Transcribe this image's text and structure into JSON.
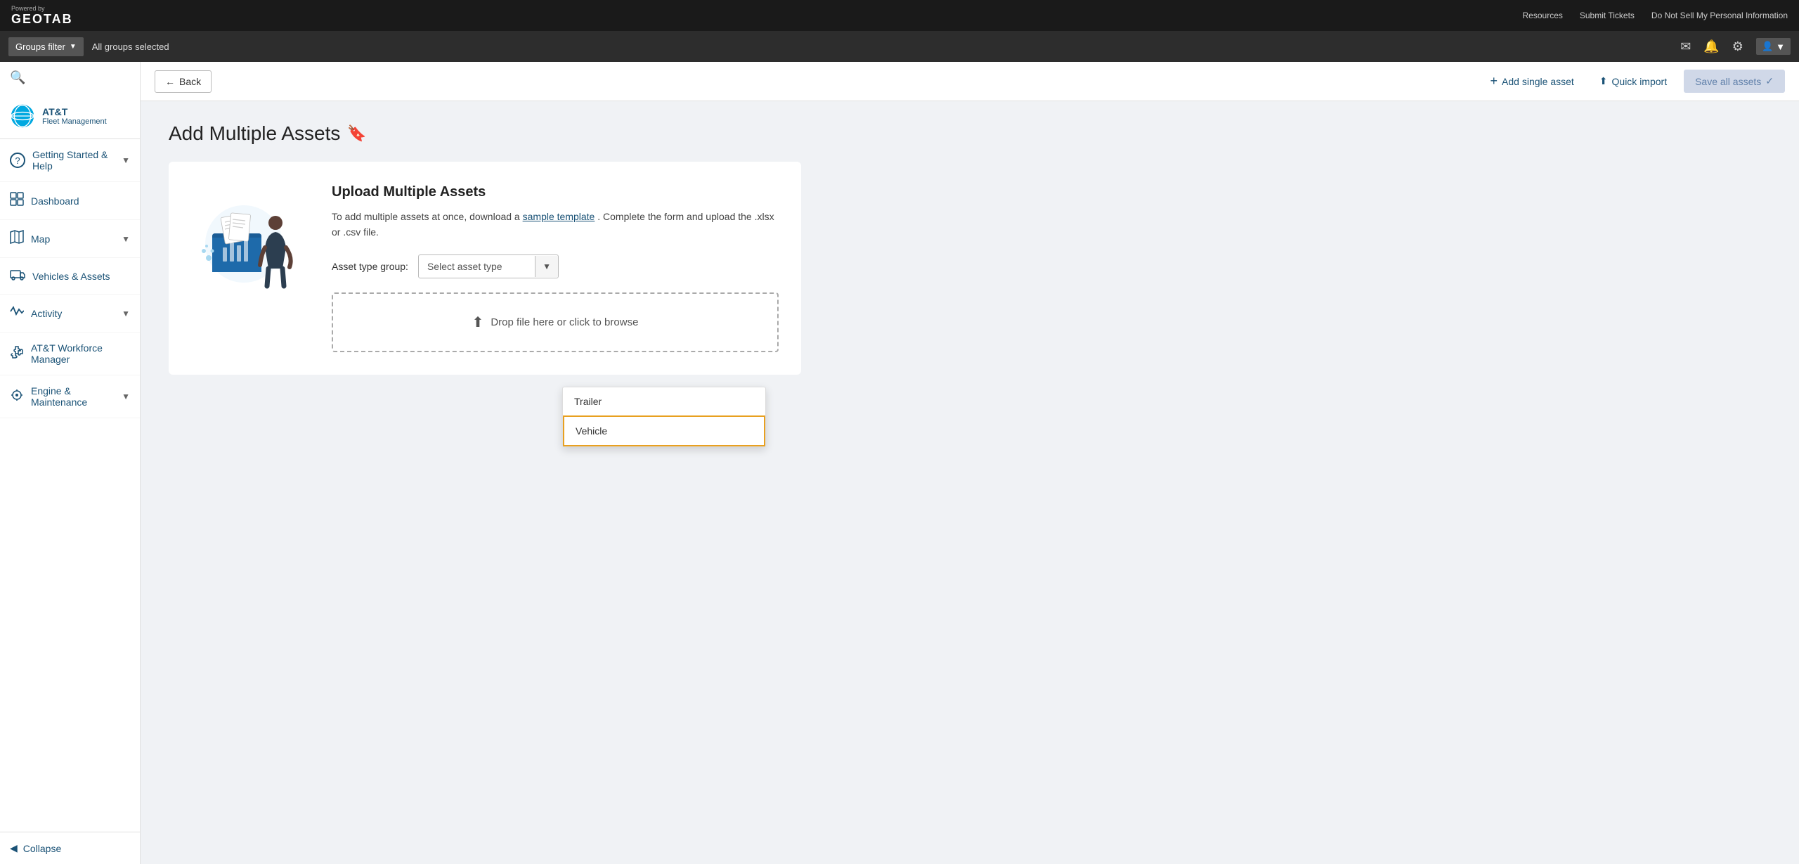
{
  "topNav": {
    "poweredBy": "Powered by",
    "geotab": "GEOTAB",
    "links": [
      "Resources",
      "Submit Tickets",
      "Do Not Sell My Personal Information"
    ]
  },
  "groupsBar": {
    "filterLabel": "Groups filter",
    "selectedText": "All groups selected",
    "icons": [
      "envelope",
      "bell",
      "gear",
      "user"
    ]
  },
  "sidebar": {
    "brand": {
      "logoAlt": "AT&T Logo",
      "name": "AT&T",
      "subtitle": "Fleet Management"
    },
    "navItems": [
      {
        "id": "getting-started",
        "icon": "?",
        "label": "Getting Started & Help",
        "hasChevron": true
      },
      {
        "id": "dashboard",
        "icon": "📊",
        "label": "Dashboard",
        "hasChevron": false
      },
      {
        "id": "map",
        "icon": "🗺",
        "label": "Map",
        "hasChevron": true
      },
      {
        "id": "vehicles-assets",
        "icon": "🚛",
        "label": "Vehicles & Assets",
        "hasChevron": false
      },
      {
        "id": "activity",
        "icon": "📈",
        "label": "Activity",
        "hasChevron": true
      },
      {
        "id": "att-workforce",
        "icon": "🧩",
        "label": "AT&T Workforce Manager",
        "hasChevron": false
      },
      {
        "id": "engine-maintenance",
        "icon": "🎬",
        "label": "Engine & Maintenance",
        "hasChevron": true
      }
    ],
    "collapse": "Collapse"
  },
  "toolbar": {
    "backLabel": "Back",
    "addSingleAsset": "Add single asset",
    "quickImport": "Quick import",
    "saveAllAssets": "Save all assets"
  },
  "page": {
    "title": "Add Multiple Assets",
    "bookmarkIconLabel": "bookmark"
  },
  "uploadCard": {
    "title": "Upload Multiple Assets",
    "descPart1": "To add multiple assets at once, download a",
    "sampleTemplateLink": "sample template",
    "descPart2": ". Complete the form and upload the .xlsx or .csv file.",
    "assetTypeLabel": "Asset type group:",
    "assetTypeSelectPlaceholder": "Select asset type",
    "dropZoneText": "Drop file here or click to browse"
  },
  "dropdown": {
    "options": [
      {
        "id": "trailer",
        "label": "Trailer",
        "selected": false
      },
      {
        "id": "vehicle",
        "label": "Vehicle",
        "selected": true
      }
    ]
  }
}
